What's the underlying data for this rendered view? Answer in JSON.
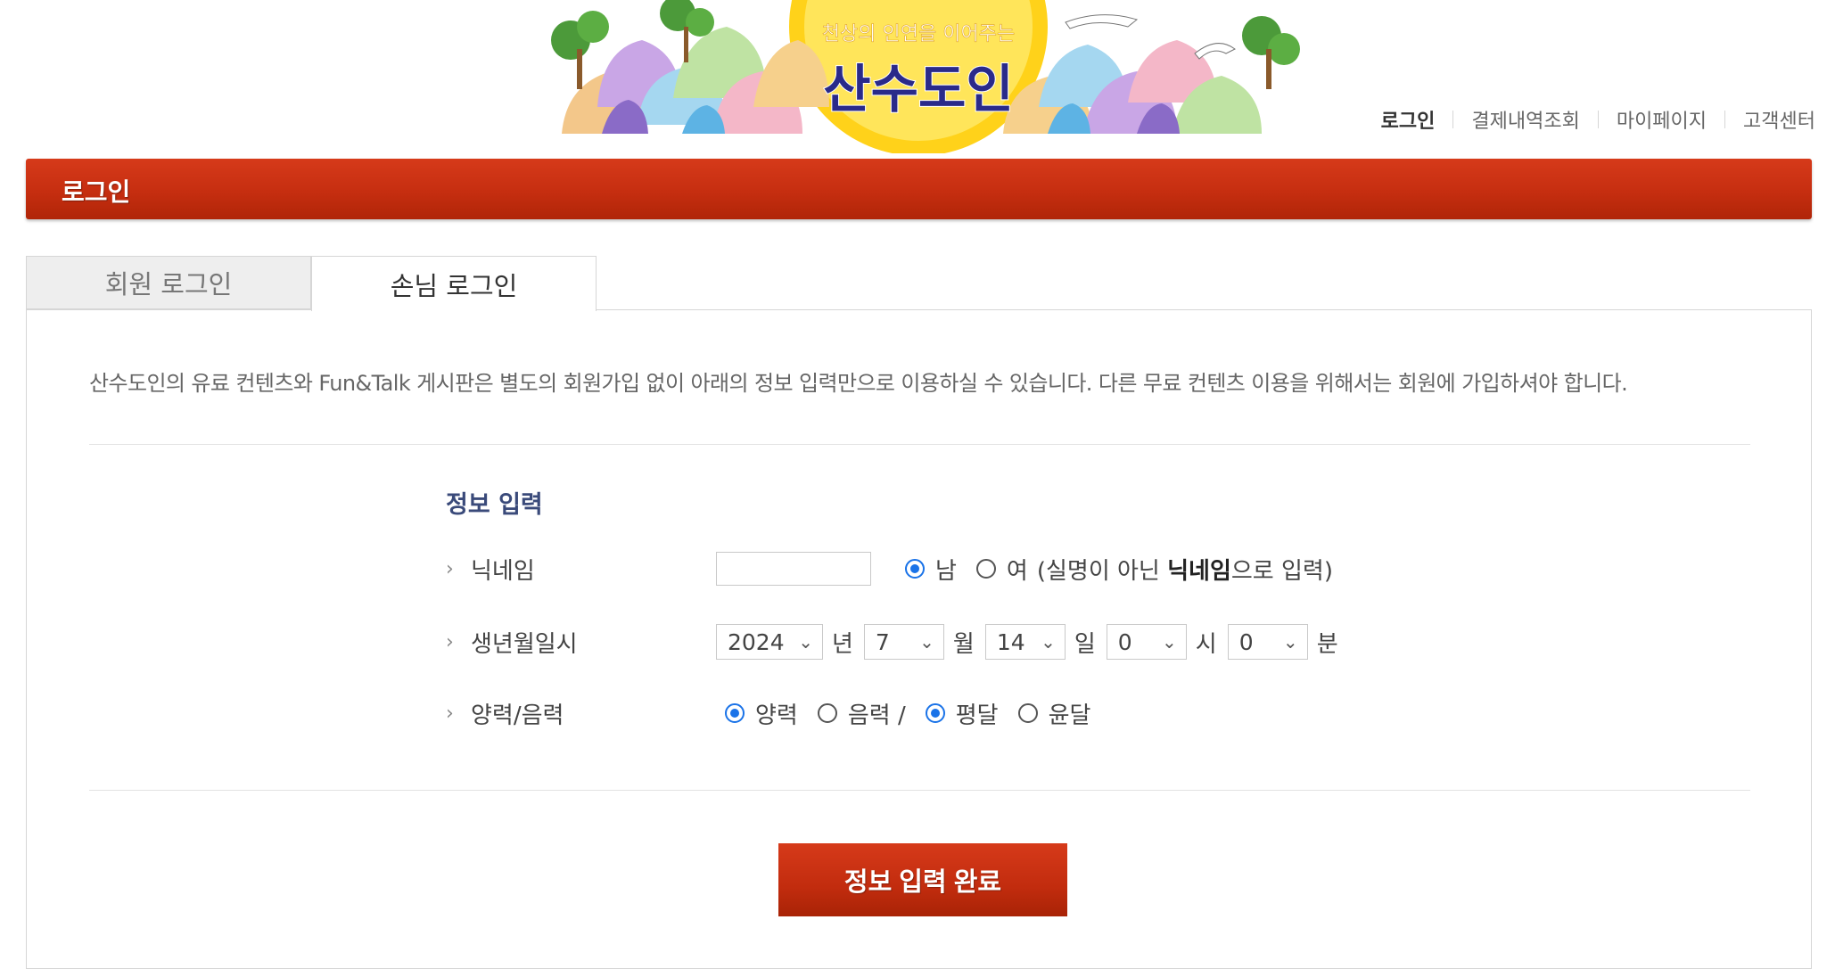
{
  "header": {
    "logo_tagline": "천상의 인연을 이어주는",
    "logo_name": "산수도인",
    "nav": [
      {
        "label": "로그인"
      },
      {
        "label": "결제내역조회"
      },
      {
        "label": "마이페이지"
      },
      {
        "label": "고객센터"
      }
    ]
  },
  "page_title": "로그인",
  "tabs": [
    {
      "label": "회원 로그인"
    },
    {
      "label": "손님 로그인"
    }
  ],
  "notice": "산수도인의 유료 컨텐츠와 Fun&Talk 게시판은 별도의 회원가입 없이 아래의 정보 입력만으로 이용하실 수 있습니다. 다른 무료 컨텐츠 이용을 위해서는 회원에 가입하셔야 합니다.",
  "form": {
    "section_title": "정보 입력",
    "nickname": {
      "label": "닉네임",
      "value": "",
      "gender_male": "남",
      "gender_female": "여",
      "hint_prefix": "(실명이 아닌 ",
      "hint_bold": "닉네임",
      "hint_suffix": "으로 입력)"
    },
    "birth": {
      "label": "생년월일시",
      "year": "2024",
      "year_unit": "년",
      "month": "7",
      "month_unit": "월",
      "day": "14",
      "day_unit": "일",
      "hour": "0",
      "hour_unit": "시",
      "minute": "0",
      "minute_unit": "분"
    },
    "calendar": {
      "label": "양력/음력",
      "solar": "양력",
      "lunar": "음력 /",
      "normal_month": "평달",
      "leap_month": "윤달"
    },
    "submit": "정보 입력 완료"
  },
  "colors": {
    "title_bar": "#c62e10",
    "section_title": "#3a4a7a",
    "radio_selected": "#1a73e8"
  }
}
